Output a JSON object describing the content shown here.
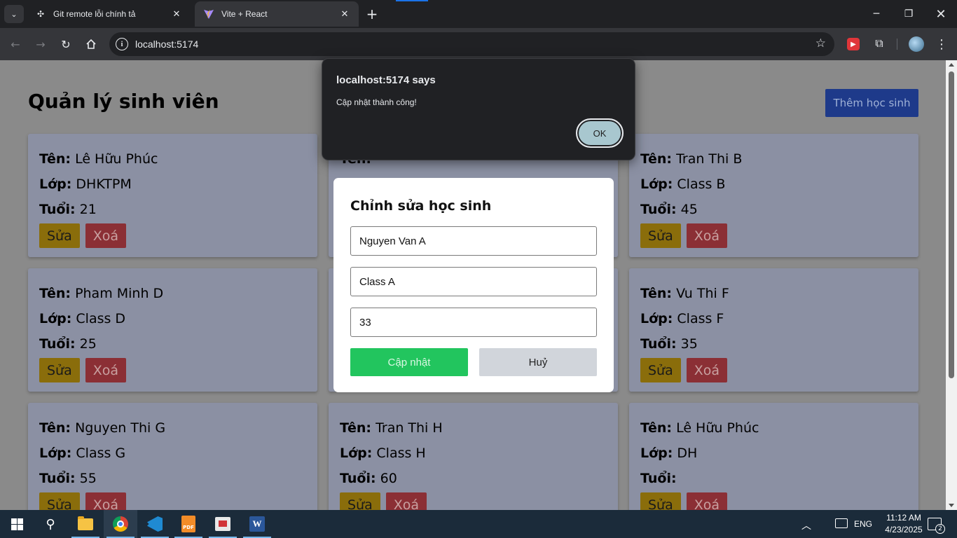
{
  "browser": {
    "tabs": [
      {
        "title": "Git remote lỗi chính tả",
        "icon": "chatgpt-icon",
        "active": false
      },
      {
        "title": "Vite + React",
        "icon": "vite-icon",
        "active": true
      }
    ],
    "url": "localhost:5174"
  },
  "page": {
    "title": "Quản lý sinh viên",
    "add_button": "Thêm học sinh",
    "labels": {
      "name": "Tên:",
      "class": "Lớp:",
      "age": "Tuổi:"
    },
    "edit_label": "Sửa",
    "delete_label": "Xoá",
    "students": [
      {
        "name": "Lê Hữu Phúc",
        "class": "DHKTPM",
        "age": "21"
      },
      {
        "name": "",
        "class": "",
        "age": ""
      },
      {
        "name": "Tran Thi B",
        "class": "Class B",
        "age": "45"
      },
      {
        "name": "Pham Minh D",
        "class": "Class D",
        "age": "25"
      },
      {
        "name": "",
        "class": "",
        "age": ""
      },
      {
        "name": "Vu Thi F",
        "class": "Class F",
        "age": "35"
      },
      {
        "name": "Nguyen Thi G",
        "class": "Class G",
        "age": "55"
      },
      {
        "name": "Tran Thi H",
        "class": "Class H",
        "age": "60"
      },
      {
        "name": "Lê Hữu Phúc",
        "class": "DH",
        "age": ""
      }
    ]
  },
  "modal": {
    "title": "Chỉnh sửa học sinh",
    "name_value": "Nguyen Van A",
    "class_value": "Class A",
    "age_value": "33",
    "update_label": "Cập nhật",
    "cancel_label": "Huỷ"
  },
  "alert": {
    "title": "localhost:5174 says",
    "message": "Cập nhật thành công!",
    "ok_label": "OK"
  },
  "taskbar": {
    "lang": "ENG",
    "time": "11:12 AM",
    "date": "4/23/2025",
    "notifications": "2"
  }
}
